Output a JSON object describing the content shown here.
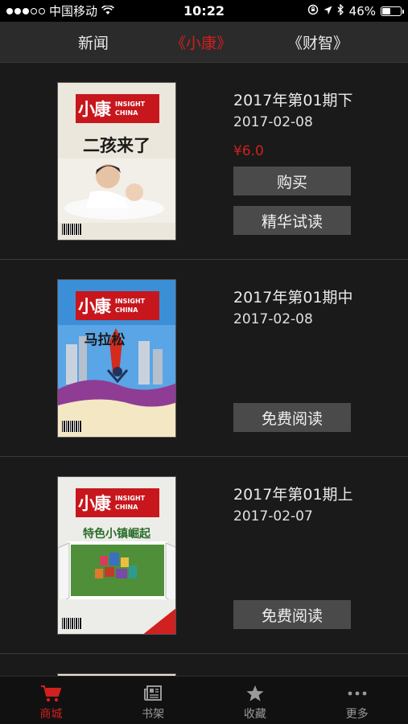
{
  "status_bar": {
    "carrier": "中国移动",
    "time": "10:22",
    "battery": "46%",
    "battery_level": 0.46
  },
  "tabs": [
    {
      "label": "新闻",
      "active": false
    },
    {
      "label": "《小康》",
      "active": true
    },
    {
      "label": "《财智》",
      "active": false
    }
  ],
  "issues": [
    {
      "title": "2017年第01期下",
      "date": "2017-02-08",
      "price": "¥6.0",
      "buttons": [
        "购买",
        "精华试读"
      ],
      "cover": {
        "logo_cn": "小康",
        "logo_en_1": "INSIGHT",
        "logo_en_2": "CHINA",
        "headline": "二孩来了"
      }
    },
    {
      "title": "2017年第01期中",
      "date": "2017-02-08",
      "buttons": [
        "免费阅读"
      ],
      "cover": {
        "logo_cn": "小康",
        "logo_en_1": "INSIGHT",
        "logo_en_2": "CHINA",
        "headline": "马拉松"
      }
    },
    {
      "title": "2017年第01期上",
      "date": "2017-02-07",
      "buttons": [
        "免费阅读"
      ],
      "cover": {
        "logo_cn": "小康",
        "logo_en_1": "INSIGHT",
        "logo_en_2": "CHINA",
        "headline": "特色小镇崛起"
      }
    }
  ],
  "bottom_nav": [
    {
      "label": "商城",
      "icon": "cart-icon",
      "active": true
    },
    {
      "label": "书架",
      "icon": "newspaper-icon",
      "active": false
    },
    {
      "label": "收藏",
      "icon": "star-icon",
      "active": false
    },
    {
      "label": "更多",
      "icon": "more-icon",
      "active": false
    }
  ],
  "colors": {
    "accent": "#d0201f",
    "background": "#1a1a1a",
    "button": "#4a4a4a"
  }
}
